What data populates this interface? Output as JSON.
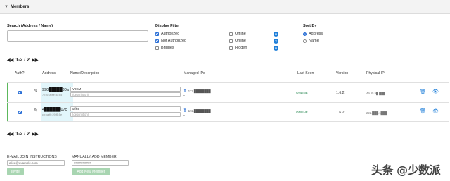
{
  "header": {
    "title": "Members"
  },
  "search": {
    "label": "Search (Address / Name)",
    "value": "",
    "placeholder": ""
  },
  "filter": {
    "label": "Display Filter",
    "options": [
      {
        "label": "Authorized",
        "checked": true
      },
      {
        "label": "Offline",
        "checked": false,
        "count": "0"
      },
      {
        "label": "Not Authorized",
        "checked": true
      },
      {
        "label": "Online",
        "checked": false,
        "count": "2"
      },
      {
        "label": "Bridges",
        "checked": false
      },
      {
        "label": "Hidden",
        "checked": false,
        "count": "0"
      }
    ]
  },
  "sort": {
    "label": "Sort By",
    "options": [
      {
        "label": "Address",
        "selected": true
      },
      {
        "label": "Name",
        "selected": false
      }
    ]
  },
  "pager": {
    "text": "1-2 / 2"
  },
  "columns": {
    "auth": "Auth?",
    "address": "Address",
    "name": "Name/Description",
    "ips": "Managed IPs",
    "last_seen": "Last Seen",
    "version": "Version",
    "physical_ip": "Physical IP"
  },
  "members": [
    {
      "authorized": true,
      "address": "990█████30a",
      "address_sub": "7c:f0:0f:ee:d1:e5",
      "name": "VDSM",
      "description_placeholder": "(description)",
      "ip": "172.████████",
      "ip_add": "+",
      "last_seen": "ONLINE",
      "version": "1.6.2",
      "physical_ip": "49.65.9█.███"
    },
    {
      "authorized": true,
      "address": "4██████07c",
      "address_sub": "cb:ca:f0:29:f5:5e",
      "name": "office",
      "description_placeholder": "(description)",
      "ip": "172.████████",
      "ip_add": "+",
      "last_seen": "ONLINE",
      "version": "1.6.2",
      "physical_ip": "222.███.1███"
    }
  ],
  "footer": {
    "email_label": "E-MAIL JOIN INSTRUCTIONS",
    "email_placeholder": "alice@example.com",
    "invite_label": "Invite",
    "manual_label": "MANUALLY ADD MEMBER",
    "manual_placeholder": "##########",
    "add_label": "Add New Member"
  },
  "watermark": "头条 @少数派",
  "colors": {
    "accent": "#1f7fd9",
    "online": "#2e8b57",
    "authorized_bar": "#5cb85c",
    "button": "#a8d5b1"
  }
}
